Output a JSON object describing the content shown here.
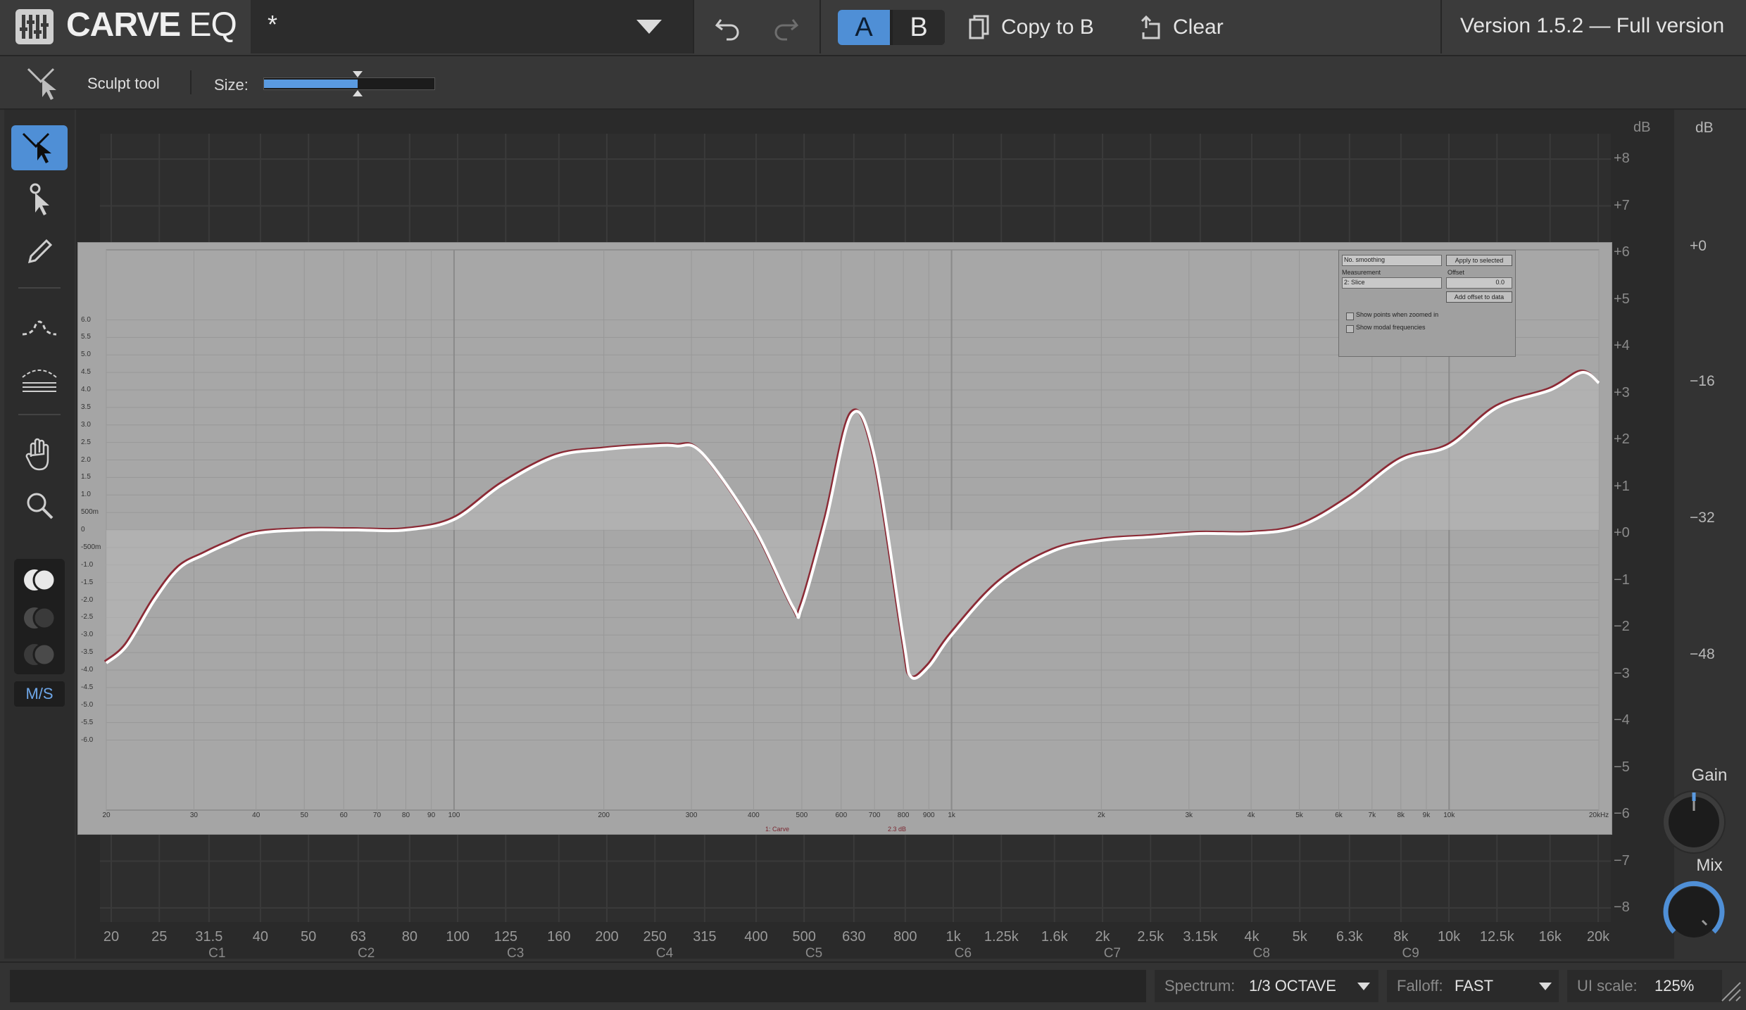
{
  "app": {
    "title_bold": "CARVE",
    "title_thin": "EQ",
    "preset_name": "*",
    "version": "Version 1.5.2 — Full version"
  },
  "toolbar": {
    "a_label": "A",
    "b_label": "B",
    "copy_label": "Copy to B",
    "clear_label": "Clear"
  },
  "sculpt": {
    "tool_label": "Sculpt tool",
    "size_label": "Size:",
    "size_value": 0.55
  },
  "left_tools": [
    {
      "icon": "sculpt-tool-icon",
      "selected": true
    },
    {
      "icon": "pointer-tool-icon",
      "selected": false
    },
    {
      "icon": "pencil-tool-icon",
      "selected": false
    },
    {
      "icon": "bell-curve-tool-icon",
      "selected": false
    },
    {
      "icon": "multi-curve-tool-icon",
      "selected": false
    },
    {
      "icon": "hand-tool-icon",
      "selected": false
    },
    {
      "icon": "zoom-tool-icon",
      "selected": false
    }
  ],
  "ms_label": "M/S",
  "graph": {
    "db_unit": "dB",
    "db_ticks": [
      "+8",
      "+7",
      "+6",
      "+5",
      "+4",
      "+3",
      "+2",
      "+1",
      "+0",
      "−1",
      "−2",
      "−3",
      "−4",
      "−5",
      "−6",
      "−7",
      "−8"
    ],
    "meter_unit": "dB",
    "meter_ticks": [
      "+0",
      "−16",
      "−32",
      "−48"
    ],
    "freq_ticks": [
      "20",
      "25",
      "31.5",
      "40",
      "50",
      "63",
      "80",
      "100",
      "125",
      "160",
      "200",
      "250",
      "315",
      "400",
      "500",
      "630",
      "800",
      "1k",
      "1.25k",
      "1.6k",
      "2k",
      "2.5k",
      "3.15k",
      "4k",
      "5k",
      "6.3k",
      "8k",
      "10k",
      "12.5k",
      "16k",
      "20k"
    ],
    "note_ticks": [
      "C1",
      "C2",
      "C3",
      "C4",
      "C5",
      "C6",
      "C7",
      "C8",
      "C9"
    ]
  },
  "overlay": {
    "y_ticks": [
      "6.0",
      "5.5",
      "5.0",
      "4.5",
      "4.0",
      "3.5",
      "3.0",
      "2.5",
      "2.0",
      "1.5",
      "1.0",
      "500m",
      "0",
      "-500m",
      "-1.0",
      "-1.5",
      "-2.0",
      "-2.5",
      "-3.0",
      "-3.5",
      "-4.0",
      "-4.5",
      "-5.0",
      "-5.5",
      "-6.0"
    ],
    "x_ticks": [
      "20",
      "30",
      "40",
      "50",
      "60",
      "70",
      "80",
      "90",
      "100",
      "200",
      "300",
      "400",
      "500",
      "600",
      "700",
      "800",
      "900",
      "1k",
      "2k",
      "3k",
      "4k",
      "5k",
      "6k",
      "7k",
      "8k",
      "9k",
      "10k",
      "20kHz"
    ],
    "legend_label": "1: Carve",
    "legend_value": "2.3 dB",
    "smoothing": "No. smoothing",
    "apply_label": "Apply to selected",
    "measurement_label": "Measurement",
    "measurement_value": "2: Slice",
    "offset_label": "Offset",
    "offset_value": "0.0",
    "add_offset_label": "Add offset to data",
    "check1": "Show points when zoomed in",
    "check2": "Show modal frequencies"
  },
  "chart_data": {
    "type": "line",
    "title": "",
    "xlabel": "",
    "ylabel": "dB",
    "xscale": "log",
    "xlim": [
      20,
      20000
    ],
    "ylim": [
      -8,
      8
    ],
    "series": [
      {
        "x": [
          20,
          22,
          25,
          28,
          31.5,
          35,
          40,
          50,
          63,
          80,
          100,
          125,
          160,
          200,
          250,
          280,
          315,
          400,
          480,
          500,
          560,
          630,
          700,
          800,
          830,
          900,
          1000,
          1250,
          1600,
          2000,
          2500,
          3150,
          4000,
          5000,
          6300,
          8000,
          10000,
          12500,
          16000,
          18500,
          20000
        ],
        "values": [
          -3.8,
          -3.3,
          -2.0,
          -1.1,
          -0.7,
          -0.4,
          -0.1,
          0.0,
          0.0,
          0.0,
          0.3,
          1.3,
          2.1,
          2.3,
          2.4,
          2.4,
          2.2,
          0.1,
          -2.2,
          -2.2,
          0.3,
          3.3,
          2.1,
          -3.1,
          -4.2,
          -3.9,
          -3.0,
          -1.5,
          -0.6,
          -0.3,
          -0.2,
          -0.1,
          -0.1,
          0.1,
          0.9,
          2.0,
          2.4,
          3.5,
          4.0,
          4.5,
          4.2
        ]
      }
    ]
  },
  "knobs": {
    "gain_label": "Gain",
    "gain_value": 0.5,
    "mix_label": "Mix",
    "mix_value": 1.0
  },
  "bottom": {
    "spectrum_label": "Spectrum:",
    "spectrum_value": "1/3 OCTAVE",
    "falloff_label": "Falloff:",
    "falloff_value": "FAST",
    "uiscale_label": "UI scale:",
    "uiscale_value": "125%"
  },
  "colors": {
    "accent": "#4f8fd6",
    "curve": "#ffffff",
    "curve_shadow": "#8b2a35"
  }
}
